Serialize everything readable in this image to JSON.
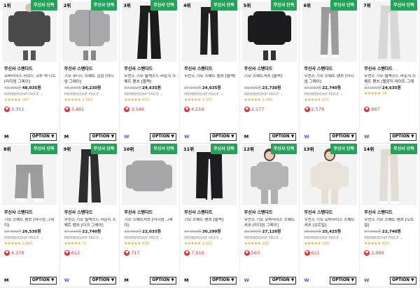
{
  "badge_label": "무신사 단독",
  "option_label": "OPTION ▼",
  "member_label": "MEMBERSHIP PRICE",
  "rows": [
    [
      {
        "rank": "1위",
        "brand": "무신사 스탠다드",
        "name": "오버사이즈 리브드 크루 넥 니트 [미디엄 그레이]",
        "orig": "73,900원",
        "price": "48,035원",
        "member": true,
        "reviews": "387",
        "likes": "3,351",
        "tag": "M",
        "img": "dark-knit"
      },
      {
        "rank": "2위",
        "brand": "무신사 스탠다드",
        "name": "기모 후디드 스웨트 집업 [미디엄 그레이]",
        "orig": "48,900원",
        "price": "34,230원",
        "member": true,
        "reviews": "1,563",
        "likes": "3,481",
        "tag": "M",
        "img": "grey-zipup"
      },
      {
        "rank": "3위",
        "brand": "무신사 스탠다드",
        "name": "우먼즈 기모 릴랙스드 라운지 스웨트 팬츠 [블랙]",
        "orig": "37,900원",
        "price": "24,635원",
        "member": true,
        "reviews": "603",
        "likes": "3,549",
        "tag": "W",
        "img": "black-pants"
      },
      {
        "rank": "4위",
        "brand": "무신사 스탠다드",
        "name": "우먼즈 기모 스웨트 팬츠 [블랙]",
        "orig": "37,900원",
        "price": "24,635원",
        "member": true,
        "reviews": "1,337",
        "likes": "4,216",
        "tag": "W",
        "img": "black-joggers"
      },
      {
        "rank": "5위",
        "brand": "무신사 스탠다드",
        "name": "기모 스웨트셔츠 [블랙]",
        "orig": "33,900원",
        "price": "23,730원",
        "member": true,
        "reviews": "1,483",
        "likes": "2,177",
        "tag": "M",
        "img": "black-sweat"
      },
      {
        "rank": "6위",
        "brand": "무신사 스탠다드",
        "name": "우먼즈 기모 스웨트 팬츠 [미디엄 그레이]",
        "orig": "37,900원",
        "price": "22,740원",
        "member": true,
        "reviews": "971",
        "likes": "2,578",
        "tag": "W",
        "img": "grey-joggers"
      },
      {
        "rank": "7위",
        "brand": "무신사 스탠다드",
        "name": "우먼즈 기모 릴랙스드 라운지 스웨트 팬츠 [멜란지 라이트 그레이]",
        "orig": "37,900원",
        "price": "24,635원",
        "member": false,
        "reviews": "78",
        "likes": "887",
        "tag": "W",
        "img": "light-pants"
      }
    ],
    [
      {
        "rank": "8위",
        "brand": "무신사 스탠다드",
        "name": "기모 스웨트 팬츠 [미디엄 그레이]",
        "orig": "37,900원",
        "price": "26,530원",
        "member": true,
        "reviews": "2,843",
        "likes": "4,378",
        "tag": "M",
        "img": "grey-wide"
      },
      {
        "rank": "9위",
        "brand": "무신사 스탠다드",
        "name": "우먼즈 기모 릴랙스드 라운지 스웨트 팬츠 [다크 그레이]",
        "orig": "37,900원",
        "price": "22,740원",
        "member": true,
        "reviews": "72",
        "likes": "612",
        "tag": "W",
        "img": "dark-pants"
      },
      {
        "rank": "10위",
        "brand": "무신사 스탠다드",
        "name": "기모 스웨트셔츠 [미디엄 그레이]",
        "orig": "33,900원",
        "price": "22,035원",
        "member": true,
        "reviews": "626",
        "likes": "717",
        "tag": "M",
        "img": "grey-sweat"
      },
      {
        "rank": "11위",
        "brand": "무신사 스탠다드",
        "name": "기모 스웨트 팬츠 [블랙]",
        "orig": "37,900원",
        "price": "30,290원",
        "member": true,
        "reviews": "3,331",
        "likes": "7,916",
        "tag": "M",
        "img": "black-wide"
      },
      {
        "rank": "12위",
        "brand": "무신사 스탠다드",
        "name": "우먼즈 기모 오버사이즈 스웨트셔츠 [미디엄 그레이]",
        "orig": "33,900원",
        "price": "27,120원",
        "member": true,
        "reviews": "105",
        "likes": "563",
        "tag": "W",
        "img": "woman-grey"
      },
      {
        "rank": "13위",
        "brand": "무신사 스탠다드",
        "name": "우먼즈 기모 오버사이즈 스웨트셔츠 [오트밀]",
        "orig": "33,900원",
        "price": "25,425원",
        "member": true,
        "reviews": "165",
        "likes": "621",
        "tag": "W",
        "img": "woman-oat"
      },
      {
        "rank": "14위",
        "brand": "무신사 스탠다드",
        "name": "우먼즈 기모 스웨트 팬츠 [오트밀]",
        "orig": "37,900원",
        "price": "22,740원",
        "member": true,
        "reviews": "829",
        "likes": "2,999",
        "tag": "W",
        "img": "oat-pants"
      }
    ]
  ],
  "colors": {
    "badge": "#23a35a",
    "star": "#f39c1e",
    "heart": "#e7323a",
    "women_tag": "#6a3df2"
  }
}
